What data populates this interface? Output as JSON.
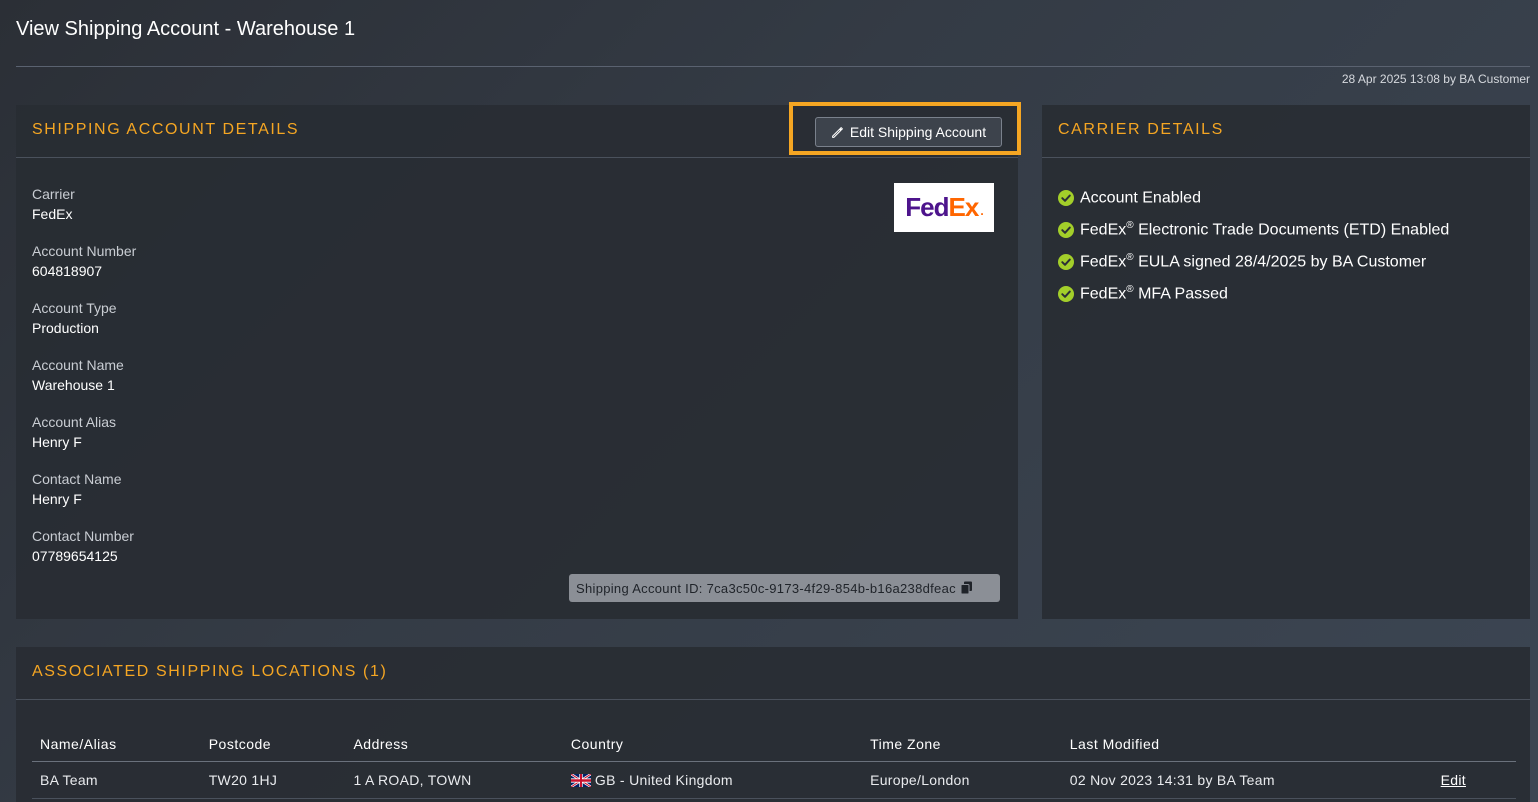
{
  "page": {
    "title": "View Shipping Account - Warehouse 1",
    "last_updated": "28 Apr 2025 13:08 by BA Customer"
  },
  "colors": {
    "accent": "#f5a623",
    "check": "#a3cf2a",
    "fedex_purple": "#4d148c",
    "fedex_orange": "#ff6600"
  },
  "account_panel": {
    "title": "SHIPPING ACCOUNT DETAILS",
    "edit_label": "Edit Shipping Account",
    "edit_icon": "pencil-icon",
    "logo": {
      "fed": "Fed",
      "ex": "Ex",
      "dot": "."
    },
    "fields": [
      {
        "label": "Carrier",
        "value": "FedEx"
      },
      {
        "label": "Account Number",
        "value": "604818907"
      },
      {
        "label": "Account Type",
        "value": "Production"
      },
      {
        "label": "Account Name",
        "value": "Warehouse 1"
      },
      {
        "label": "Account Alias",
        "value": "Henry F"
      },
      {
        "label": "Contact Name",
        "value": "Henry F"
      },
      {
        "label": "Contact Number",
        "value": "07789654125"
      }
    ],
    "shipping_account_id": "Shipping Account ID: 7ca3c50c-9173-4f29-854b-b16a238dfeac",
    "copy_icon": "copy-icon"
  },
  "carrier_panel": {
    "title": "CARRIER DETAILS",
    "checks": [
      {
        "brand": "",
        "reg": "",
        "text": "Account Enabled"
      },
      {
        "brand": "FedEx",
        "reg": "®",
        "text": " Electronic Trade Documents (ETD) Enabled"
      },
      {
        "brand": "FedEx",
        "reg": "®",
        "text": " EULA signed 28/4/2025 by BA Customer"
      },
      {
        "brand": "FedEx",
        "reg": "®",
        "text": " MFA Passed"
      }
    ],
    "check_icon": "check-circle-icon"
  },
  "locations_panel": {
    "title": "ASSOCIATED SHIPPING LOCATIONS (1)",
    "columns": [
      "Name/Alias",
      "Postcode",
      "Address",
      "Country",
      "Time Zone",
      "Last Modified",
      ""
    ],
    "rows": [
      {
        "name": "BA Team",
        "postcode": "TW20 1HJ",
        "address": "1 A ROAD, TOWN",
        "country": "GB - United Kingdom",
        "flag_icon": "uk-flag-icon",
        "timezone": "Europe/London",
        "modified": "02 Nov 2023 14:31 by BA Team",
        "action": "Edit"
      }
    ]
  }
}
